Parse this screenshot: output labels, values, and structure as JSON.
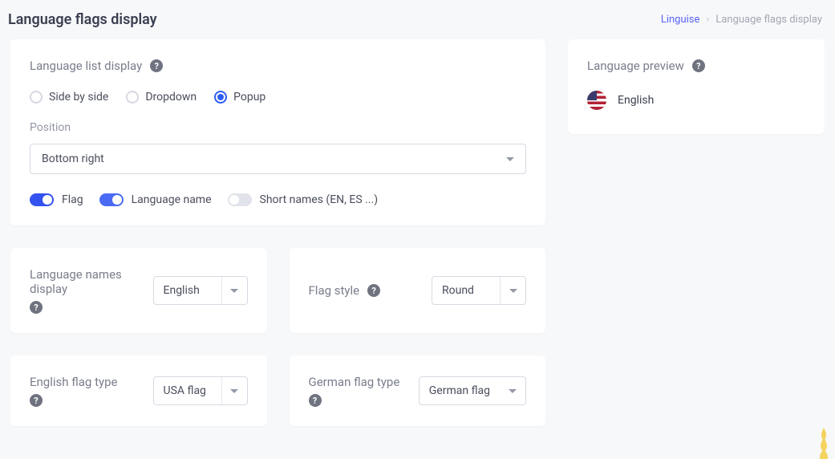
{
  "header": {
    "title": "Language flags display",
    "breadcrumb": {
      "link": "Linguise",
      "current": "Language flags display"
    }
  },
  "listDisplay": {
    "label": "Language list display",
    "options": [
      "Side by side",
      "Dropdown",
      "Popup"
    ],
    "selectedIndex": 2,
    "positionLabel": "Position",
    "positionValue": "Bottom right",
    "toggles": {
      "flag": {
        "label": "Flag",
        "on": true
      },
      "langName": {
        "label": "Language name",
        "on": true
      },
      "shortNames": {
        "label": "Short names (EN, ES ...)",
        "on": false
      }
    }
  },
  "langNamesDisplay": {
    "label": "Language names display",
    "value": "English"
  },
  "flagStyle": {
    "label": "Flag style",
    "value": "Round"
  },
  "englishFlagType": {
    "label": "English flag type",
    "value": "USA flag"
  },
  "germanFlagType": {
    "label": "German flag type",
    "value": "German flag"
  },
  "preview": {
    "label": "Language preview",
    "value": "English"
  }
}
